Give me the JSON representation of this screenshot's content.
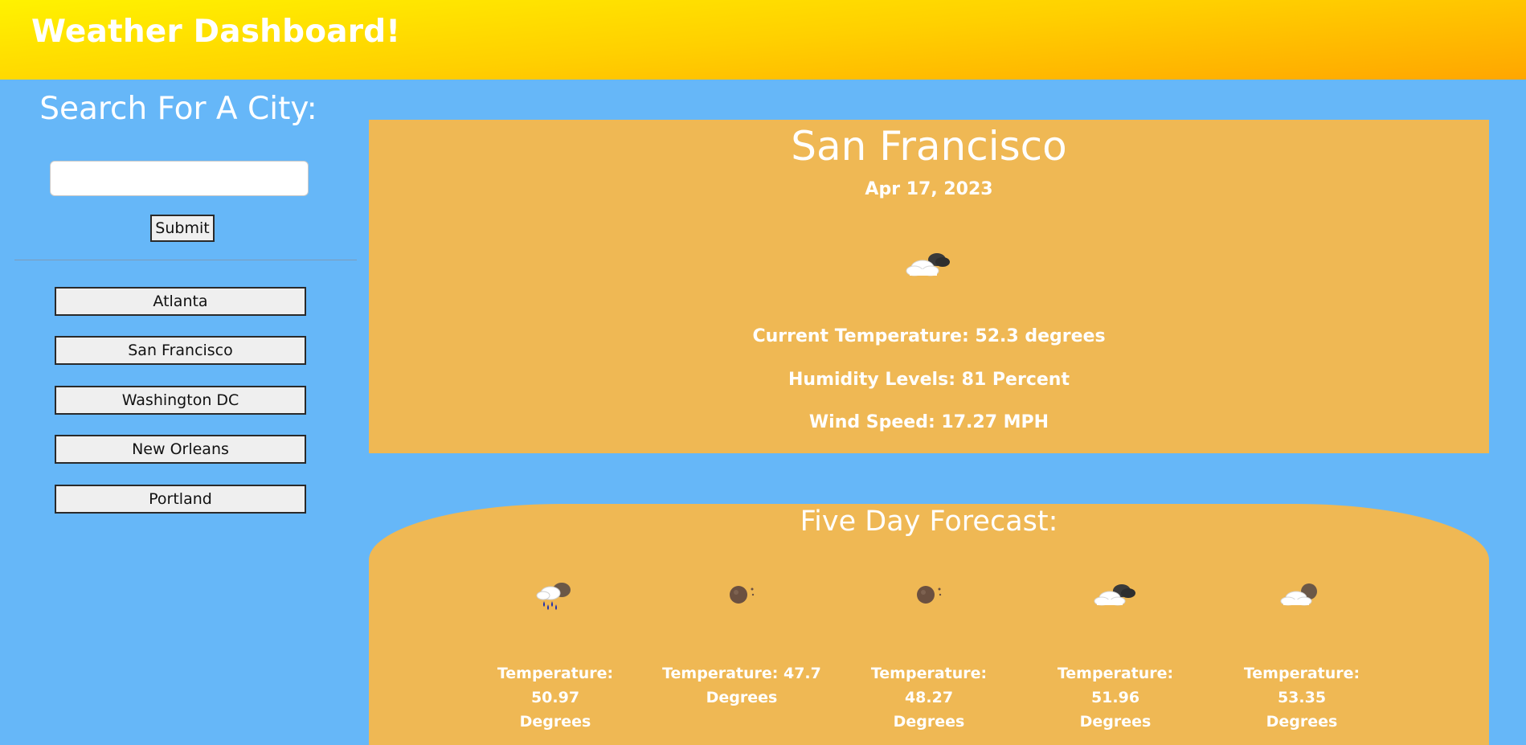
{
  "header": {
    "title": "Weather Dashboard!"
  },
  "sidebar": {
    "search_title": "Search For A City:",
    "search_value": "",
    "submit_label": "Submit",
    "cities": [
      "Atlanta",
      "San Francisco",
      "Washington DC",
      "New Orleans",
      "Portland"
    ]
  },
  "current": {
    "city": "San Francisco",
    "date": "Apr 17, 2023",
    "icon": "partly-cloudy-night-icon",
    "temperature": "Current Temperature: 52.3 degrees",
    "humidity": "Humidity Levels: 81 Percent",
    "wind": "Wind Speed: 17.27 MPH"
  },
  "forecast": {
    "title": "Five Day Forecast:",
    "days": [
      {
        "icon": "rain-night-icon",
        "temp_line1": "Temperature: 50.97",
        "temp_line2": "Degrees"
      },
      {
        "icon": "clear-night-icon",
        "temp_line1": "Temperature: 47.7",
        "temp_line2": "Degrees"
      },
      {
        "icon": "clear-night-icon",
        "temp_line1": "Temperature: 48.27",
        "temp_line2": "Degrees"
      },
      {
        "icon": "cloudy-night-icon",
        "temp_line1": "Temperature: 51.96",
        "temp_line2": "Degrees"
      },
      {
        "icon": "partly-cloudy-night-icon",
        "temp_line1": "Temperature: 53.35",
        "temp_line2": "Degrees"
      }
    ]
  },
  "colors": {
    "background": "#66b7f8",
    "card": "#efb854",
    "header_gradient_start": "#fff200",
    "header_gradient_end": "#ffa600"
  }
}
